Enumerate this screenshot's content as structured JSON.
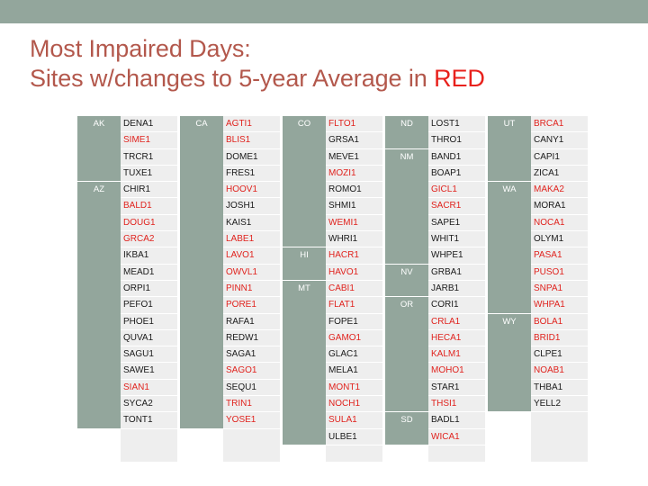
{
  "banner": {
    "name": "top-banner"
  },
  "title": {
    "line1": "Most Impaired Days:",
    "line2_prefix": "Sites w/changes to 5-year Average in ",
    "line2_highlight": "RED",
    "color_normal": "#b3584c",
    "color_highlight": "#e8211c"
  },
  "legend": {
    "changed_color": "#e0231e",
    "unchanged_color": "#1a1a1a",
    "state_cell_color": "#93a69c",
    "site_cell_color": "#eeeeee"
  },
  "columns": [
    {
      "index": 1,
      "groups": [
        {
          "state": "AK",
          "sites": [
            {
              "code": "DENA1",
              "changed": false
            },
            {
              "code": "SIME1",
              "changed": true
            },
            {
              "code": "TRCR1",
              "changed": false
            },
            {
              "code": "TUXE1",
              "changed": false
            }
          ]
        },
        {
          "state": "AZ",
          "sites": [
            {
              "code": "CHIR1",
              "changed": false
            },
            {
              "code": "BALD1",
              "changed": true
            },
            {
              "code": "DOUG1",
              "changed": true
            },
            {
              "code": "GRCA2",
              "changed": true
            },
            {
              "code": "IKBA1",
              "changed": false
            },
            {
              "code": "MEAD1",
              "changed": false
            },
            {
              "code": "ORPI1",
              "changed": false
            },
            {
              "code": "PEFO1",
              "changed": false
            },
            {
              "code": "PHOE1",
              "changed": false
            },
            {
              "code": "QUVA1",
              "changed": false
            },
            {
              "code": "SAGU1",
              "changed": false
            },
            {
              "code": "SAWE1",
              "changed": false
            },
            {
              "code": "SIAN1",
              "changed": true
            },
            {
              "code": "SYCA2",
              "changed": false
            },
            {
              "code": "TONT1",
              "changed": false
            }
          ]
        }
      ]
    },
    {
      "index": 2,
      "groups": [
        {
          "state": "CA",
          "sites": [
            {
              "code": "AGTI1",
              "changed": true
            },
            {
              "code": "BLIS1",
              "changed": true
            },
            {
              "code": "DOME1",
              "changed": false
            },
            {
              "code": "FRES1",
              "changed": false
            },
            {
              "code": "HOOV1",
              "changed": true
            },
            {
              "code": "JOSH1",
              "changed": false
            },
            {
              "code": "KAIS1",
              "changed": false
            },
            {
              "code": "LABE1",
              "changed": true
            },
            {
              "code": "LAVO1",
              "changed": true
            },
            {
              "code": "OWVL1",
              "changed": true
            },
            {
              "code": "PINN1",
              "changed": true
            },
            {
              "code": "PORE1",
              "changed": true
            },
            {
              "code": "RAFA1",
              "changed": false
            },
            {
              "code": "REDW1",
              "changed": false
            },
            {
              "code": "SAGA1",
              "changed": false
            },
            {
              "code": "SAGO1",
              "changed": true
            },
            {
              "code": "SEQU1",
              "changed": false
            },
            {
              "code": "TRIN1",
              "changed": true
            },
            {
              "code": "YOSE1",
              "changed": true
            }
          ]
        }
      ]
    },
    {
      "index": 3,
      "groups": [
        {
          "state": "CO",
          "sites": [
            {
              "code": "FLTO1",
              "changed": true
            },
            {
              "code": "GRSA1",
              "changed": false
            },
            {
              "code": "MEVE1",
              "changed": false
            },
            {
              "code": "MOZI1",
              "changed": true
            },
            {
              "code": "ROMO1",
              "changed": false
            },
            {
              "code": "SHMI1",
              "changed": false
            },
            {
              "code": "WEMI1",
              "changed": true
            },
            {
              "code": "WHRI1",
              "changed": false
            }
          ]
        },
        {
          "state": "HI",
          "sites": [
            {
              "code": "HACR1",
              "changed": true
            },
            {
              "code": "HAVO1",
              "changed": true
            }
          ]
        },
        {
          "state": "MT",
          "sites": [
            {
              "code": "CABI1",
              "changed": true
            },
            {
              "code": "FLAT1",
              "changed": true
            },
            {
              "code": "FOPE1",
              "changed": false
            },
            {
              "code": "GAMO1",
              "changed": true
            },
            {
              "code": "GLAC1",
              "changed": false
            },
            {
              "code": "MELA1",
              "changed": false
            },
            {
              "code": "MONT1",
              "changed": true
            },
            {
              "code": "NOCH1",
              "changed": true
            },
            {
              "code": "SULA1",
              "changed": true
            },
            {
              "code": "ULBE1",
              "changed": false
            }
          ]
        }
      ]
    },
    {
      "index": 4,
      "groups": [
        {
          "state": "ND",
          "sites": [
            {
              "code": "LOST1",
              "changed": false
            },
            {
              "code": "THRO1",
              "changed": false
            }
          ]
        },
        {
          "state": "NM",
          "sites": [
            {
              "code": "BAND1",
              "changed": false
            },
            {
              "code": "BOAP1",
              "changed": false
            },
            {
              "code": "GICL1",
              "changed": true
            },
            {
              "code": "SACR1",
              "changed": true
            },
            {
              "code": "SAPE1",
              "changed": false
            },
            {
              "code": "WHIT1",
              "changed": false
            },
            {
              "code": "WHPE1",
              "changed": false
            }
          ]
        },
        {
          "state": "NV",
          "sites": [
            {
              "code": "GRBA1",
              "changed": false
            },
            {
              "code": "JARB1",
              "changed": false
            }
          ]
        },
        {
          "state": "OR",
          "sites": [
            {
              "code": "CORI1",
              "changed": false
            },
            {
              "code": "CRLA1",
              "changed": true
            },
            {
              "code": "HECA1",
              "changed": true
            },
            {
              "code": "KALM1",
              "changed": true
            },
            {
              "code": "MOHO1",
              "changed": true
            },
            {
              "code": "STAR1",
              "changed": false
            },
            {
              "code": "THSI1",
              "changed": true
            }
          ]
        },
        {
          "state": "SD",
          "sites": [
            {
              "code": "BADL1",
              "changed": false
            },
            {
              "code": "WICA1",
              "changed": true
            }
          ]
        }
      ]
    },
    {
      "index": 5,
      "groups": [
        {
          "state": "UT",
          "sites": [
            {
              "code": "BRCA1",
              "changed": true
            },
            {
              "code": "CANY1",
              "changed": false
            },
            {
              "code": "CAPI1",
              "changed": false
            },
            {
              "code": "ZICA1",
              "changed": false
            }
          ]
        },
        {
          "state": "WA",
          "sites": [
            {
              "code": "MAKA2",
              "changed": true
            },
            {
              "code": "MORA1",
              "changed": false
            },
            {
              "code": "NOCA1",
              "changed": true
            },
            {
              "code": "OLYM1",
              "changed": false
            },
            {
              "code": "PASA1",
              "changed": true
            },
            {
              "code": "PUSO1",
              "changed": true
            },
            {
              "code": "SNPA1",
              "changed": true
            },
            {
              "code": "WHPA1",
              "changed": true
            }
          ]
        },
        {
          "state": "WY",
          "sites": [
            {
              "code": "BOLA1",
              "changed": true
            },
            {
              "code": "BRID1",
              "changed": true
            },
            {
              "code": "CLPE1",
              "changed": false
            },
            {
              "code": "NOAB1",
              "changed": true
            },
            {
              "code": "THBA1",
              "changed": false
            },
            {
              "code": "YELL2",
              "changed": false
            }
          ]
        }
      ]
    }
  ]
}
